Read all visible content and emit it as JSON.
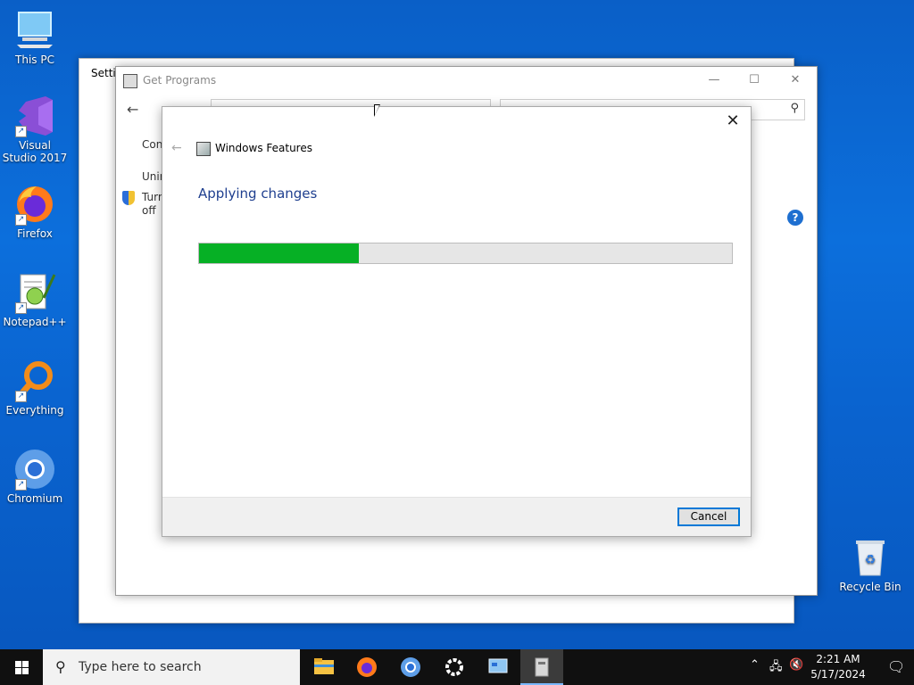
{
  "desktop": {
    "icons": [
      {
        "label": "This PC"
      },
      {
        "label": "Visual Studio 2017"
      },
      {
        "label": "Firefox"
      },
      {
        "label": "Notepad++"
      },
      {
        "label": "Everything"
      },
      {
        "label": "Chromium"
      },
      {
        "label": "Recycle Bin"
      }
    ]
  },
  "settings_window": {
    "title": "Settin"
  },
  "get_programs_window": {
    "title": "Get Programs",
    "side_texts": [
      "Con",
      "Unir",
      "Turn",
      "off"
    ],
    "minimize": "—",
    "maximize": "☐",
    "close": "✕"
  },
  "dialog": {
    "title": "Windows Features",
    "heading": "Applying changes",
    "progress_fraction": 0.3,
    "cancel_label": "Cancel",
    "close": "✕",
    "back": "←"
  },
  "taskbar": {
    "search_placeholder": "Type here to search",
    "time": "2:21 AM",
    "date": "5/17/2024"
  },
  "colors": {
    "progress_fill": "#06b025",
    "accent": "#0078d7",
    "heading": "#1f3f8f"
  }
}
